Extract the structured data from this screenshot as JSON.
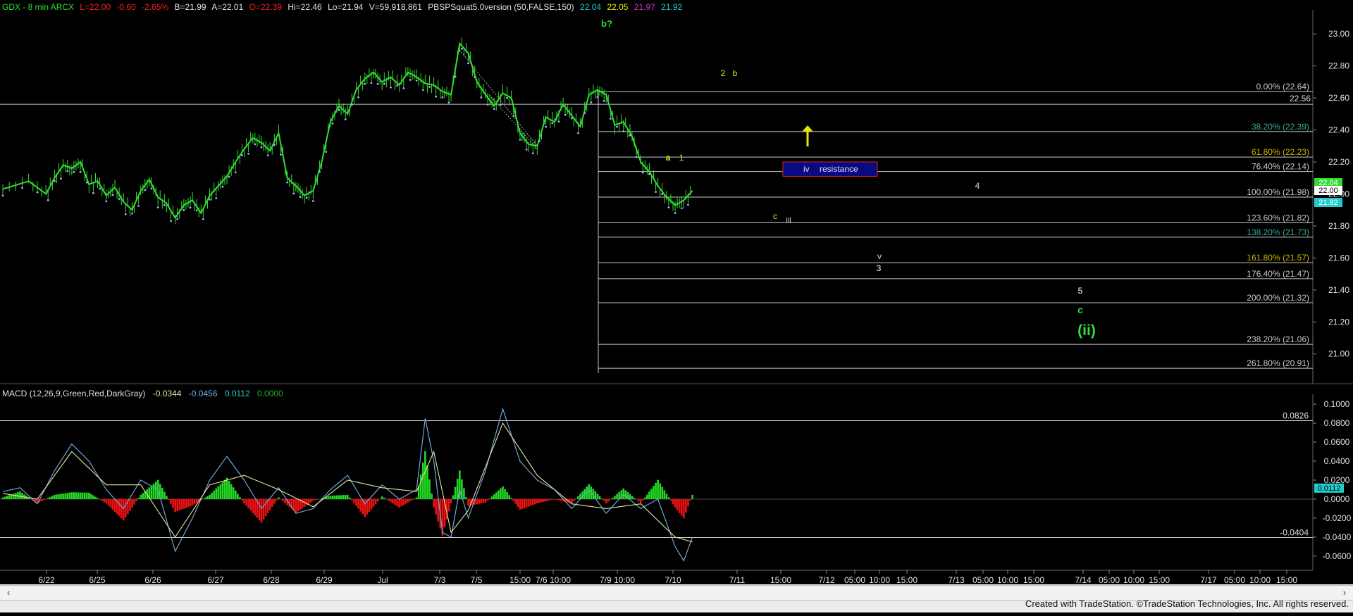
{
  "header": {
    "symbol": "GDX - 8 min  ARCX",
    "last": "L=22.00",
    "change": "-0.60",
    "pct": "-2.65%",
    "bid": "B=21.99",
    "ask": "A=22.01",
    "open": "O=22.39",
    "hi": "Hi=22.46",
    "lo": "Lo=21.94",
    "vol": "V=59,918,861",
    "study": "PBSPSquat5.0version (50,FALSE,150)",
    "v1": "22.04",
    "v2": "22.05",
    "v3": "21.97",
    "v4": "21.92"
  },
  "macd_header": {
    "name": "MACD (12,26,9,Green,Red,DarkGray)",
    "v1": "-0.0344",
    "v2": "-0.0456",
    "v3": "0.0112",
    "v4": "0.0000"
  },
  "colors": {
    "background": "#000000",
    "price": "#33dd33",
    "fib_line": "#b8b8b8",
    "resistance_fill": "#0a0a80",
    "resistance_border": "#e02020",
    "yellow_label": "#e6e600",
    "macd_pos": "#22dd22",
    "macd_neg": "#ee1111"
  },
  "footer": "Created with TradeStation. ©TradeStation Technologies, Inc. All rights reserved.",
  "chart_data": [
    {
      "type": "line",
      "title": "GDX - 8 min",
      "ylim": [
        20.88,
        23.08
      ],
      "y_ticks": [
        "23.00",
        "22.80",
        "22.60",
        "22.40",
        "22.20",
        "22.00",
        "21.80",
        "21.60",
        "21.40",
        "21.20",
        "21.00"
      ],
      "x_tick_labels": [
        "6/22",
        "6/25",
        "6/26",
        "6/27",
        "6/28",
        "6/29",
        "Jul",
        "7/3",
        "7/5",
        "15:00",
        "7/6 10:00",
        "7/9 10:00",
        "7/10",
        "7/11",
        "15:00",
        "7/12",
        "05:00",
        "10:00",
        "15:00",
        "7/13",
        "05:00",
        "10:00",
        "15:00",
        "7/14",
        "05:00",
        "10:00",
        "15:00",
        "7/17",
        "05:00",
        "10:00",
        "15:00"
      ],
      "price_series": [
        [
          0,
          22.03
        ],
        [
          3,
          22.08
        ],
        [
          5,
          22.0
        ],
        [
          6,
          22.1
        ],
        [
          7,
          22.18
        ],
        [
          8,
          22.16
        ],
        [
          9,
          22.2
        ],
        [
          10,
          22.06
        ],
        [
          11,
          22.08
        ],
        [
          12,
          21.99
        ],
        [
          13,
          22.04
        ],
        [
          14,
          21.95
        ],
        [
          15,
          21.9
        ],
        [
          16,
          22.02
        ],
        [
          17,
          22.09
        ],
        [
          18,
          21.98
        ],
        [
          19,
          21.94
        ],
        [
          20,
          21.85
        ],
        [
          21,
          21.93
        ],
        [
          22,
          21.96
        ],
        [
          23,
          21.88
        ],
        [
          24,
          21.99
        ],
        [
          25,
          22.05
        ],
        [
          26,
          22.11
        ],
        [
          27,
          22.2
        ],
        [
          28,
          22.28
        ],
        [
          29,
          22.35
        ],
        [
          30,
          22.32
        ],
        [
          31,
          22.27
        ],
        [
          32,
          22.38
        ],
        [
          33,
          22.1
        ],
        [
          34,
          22.05
        ],
        [
          35,
          21.99
        ],
        [
          36,
          22.02
        ],
        [
          37,
          22.2
        ],
        [
          38,
          22.45
        ],
        [
          39,
          22.55
        ],
        [
          40,
          22.5
        ],
        [
          41,
          22.65
        ],
        [
          42,
          22.72
        ],
        [
          43,
          22.76
        ],
        [
          44,
          22.7
        ],
        [
          45,
          22.73
        ],
        [
          46,
          22.68
        ],
        [
          47,
          22.76
        ],
        [
          48,
          22.73
        ],
        [
          49,
          22.69
        ],
        [
          50,
          22.68
        ],
        [
          51,
          22.64
        ],
        [
          52,
          22.62
        ],
        [
          53,
          22.94
        ],
        [
          54,
          22.88
        ],
        [
          55,
          22.7
        ],
        [
          56,
          22.62
        ],
        [
          57,
          22.55
        ],
        [
          58,
          22.63
        ],
        [
          59,
          22.6
        ],
        [
          60,
          22.38
        ],
        [
          61,
          22.31
        ],
        [
          62,
          22.3
        ],
        [
          63,
          22.48
        ],
        [
          64,
          22.45
        ],
        [
          65,
          22.56
        ],
        [
          66,
          22.49
        ],
        [
          67,
          22.42
        ],
        [
          68,
          22.62
        ],
        [
          69,
          22.65
        ],
        [
          70,
          22.62
        ],
        [
          71,
          22.43
        ],
        [
          72,
          22.45
        ],
        [
          73,
          22.36
        ],
        [
          74,
          22.2
        ],
        [
          75,
          22.14
        ],
        [
          76,
          22.05
        ],
        [
          77,
          21.98
        ],
        [
          78,
          21.93
        ],
        [
          79,
          21.96
        ],
        [
          80,
          22.02
        ]
      ],
      "fib_levels": [
        {
          "label": "0.00% (22.64)",
          "value": 22.64,
          "color": "#c8c8c8"
        },
        {
          "label": "38.20% (22.39)",
          "value": 22.39,
          "color": "#3aa79a"
        },
        {
          "label": "61.80% (22.23)",
          "value": 22.23,
          "color": "#c8b400"
        },
        {
          "label": "76.40% (22.14)",
          "value": 22.14,
          "color": "#c8c8c8"
        },
        {
          "label": "100.00% (21.98)",
          "value": 21.98,
          "color": "#c8c8c8"
        },
        {
          "label": "123.60% (21.82)",
          "value": 21.82,
          "color": "#c8c8c8"
        },
        {
          "label": "138.20% (21.73)",
          "value": 21.73,
          "color": "#3aa79a"
        },
        {
          "label": "161.80% (21.57)",
          "value": 21.57,
          "color": "#c8b400"
        },
        {
          "label": "176.40% (21.47)",
          "value": 21.47,
          "color": "#c8c8c8"
        },
        {
          "label": "200.00% (21.32)",
          "value": 21.32,
          "color": "#c8c8c8"
        },
        {
          "label": "238.20% (21.06)",
          "value": 21.06,
          "color": "#c8c8c8"
        },
        {
          "label": "261.80% (20.91)",
          "value": 20.91,
          "color": "#c8c8c8"
        }
      ],
      "horizontal_line": {
        "label": "22.56",
        "value": 22.56
      },
      "resistance_box": {
        "label_iv": "iv",
        "label": "resistance",
        "y_top": 22.2,
        "y_bottom": 22.11
      },
      "wave_labels": [
        {
          "text": "b?",
          "color": "#33dd33"
        },
        {
          "text": "2",
          "color": "#e6e600"
        },
        {
          "text": "b",
          "color": "#e6e600"
        },
        {
          "text": "a",
          "color": "#e6e600"
        },
        {
          "text": "1",
          "color": "#e6e600"
        },
        {
          "text": "c",
          "color": "#e6e600"
        },
        {
          "text": "iii",
          "color": "#c8d2ff"
        },
        {
          "text": "4",
          "color": "#c8d2ff"
        },
        {
          "text": "v",
          "color": "#c8d2ff"
        },
        {
          "text": "3",
          "color": "#ffffff"
        },
        {
          "text": "5",
          "color": "#ffffff"
        },
        {
          "text": "c",
          "color": "#33dd33"
        },
        {
          "text": "(ii)",
          "color": "#33dd33"
        }
      ],
      "last_price_tags": [
        {
          "text": "22.04",
          "color": "#33dd33"
        },
        {
          "text": "22.00",
          "color": "#ffffff"
        },
        {
          "text": "21.92",
          "color": "#22cccc"
        }
      ]
    },
    {
      "type": "line",
      "title": "MACD (12,26,9,Green,Red,DarkGray)",
      "ylim": [
        -0.0675,
        0.106
      ],
      "y_ticks": [
        "0.1000",
        "0.0800",
        "0.0600",
        "0.0400",
        "0.0200",
        "0.0000",
        "-0.0200",
        "-0.0400",
        "-0.0600"
      ],
      "reference_lines": [
        {
          "label": "0.0826",
          "value": 0.0826
        },
        {
          "label": "-0.0404",
          "value": -0.0404
        }
      ],
      "current_value_tag": "0.0112",
      "macd_series": [
        [
          0,
          0.008
        ],
        [
          2,
          0.012
        ],
        [
          4,
          -0.005
        ],
        [
          6,
          0.03
        ],
        [
          8,
          0.058
        ],
        [
          10,
          0.04
        ],
        [
          12,
          0.01
        ],
        [
          14,
          -0.01
        ],
        [
          16,
          0.02
        ],
        [
          18,
          0.01
        ],
        [
          20,
          -0.055
        ],
        [
          22,
          -0.02
        ],
        [
          24,
          0.02
        ],
        [
          26,
          0.045
        ],
        [
          28,
          0.02
        ],
        [
          30,
          -0.01
        ],
        [
          32,
          0.012
        ],
        [
          34,
          -0.015
        ],
        [
          36,
          -0.01
        ],
        [
          38,
          0.01
        ],
        [
          40,
          0.025
        ],
        [
          42,
          -0.005
        ],
        [
          44,
          0.015
        ],
        [
          46,
          0.0
        ],
        [
          48,
          0.01
        ],
        [
          49,
          0.085
        ],
        [
          50,
          0.04
        ],
        [
          51,
          -0.035
        ],
        [
          52,
          -0.04
        ],
        [
          53,
          0.01
        ],
        [
          54,
          -0.02
        ],
        [
          56,
          0.03
        ],
        [
          58,
          0.095
        ],
        [
          60,
          0.04
        ],
        [
          62,
          0.02
        ],
        [
          64,
          0.01
        ],
        [
          66,
          -0.01
        ],
        [
          68,
          0.01
        ],
        [
          70,
          -0.015
        ],
        [
          72,
          0.005
        ],
        [
          74,
          -0.01
        ],
        [
          76,
          0.0
        ],
        [
          78,
          -0.05
        ],
        [
          79,
          -0.065
        ],
        [
          80,
          -0.04
        ]
      ],
      "signal_series": [
        [
          0,
          0.006
        ],
        [
          4,
          0.0
        ],
        [
          8,
          0.05
        ],
        [
          12,
          0.015
        ],
        [
          16,
          0.015
        ],
        [
          20,
          -0.04
        ],
        [
          24,
          0.015
        ],
        [
          28,
          0.025
        ],
        [
          32,
          0.01
        ],
        [
          36,
          -0.008
        ],
        [
          40,
          0.02
        ],
        [
          44,
          0.012
        ],
        [
          48,
          0.008
        ],
        [
          50,
          0.05
        ],
        [
          52,
          -0.035
        ],
        [
          54,
          -0.012
        ],
        [
          58,
          0.08
        ],
        [
          62,
          0.025
        ],
        [
          66,
          -0.005
        ],
        [
          70,
          -0.01
        ],
        [
          74,
          -0.005
        ],
        [
          78,
          -0.04
        ],
        [
          80,
          -0.045
        ]
      ]
    }
  ]
}
